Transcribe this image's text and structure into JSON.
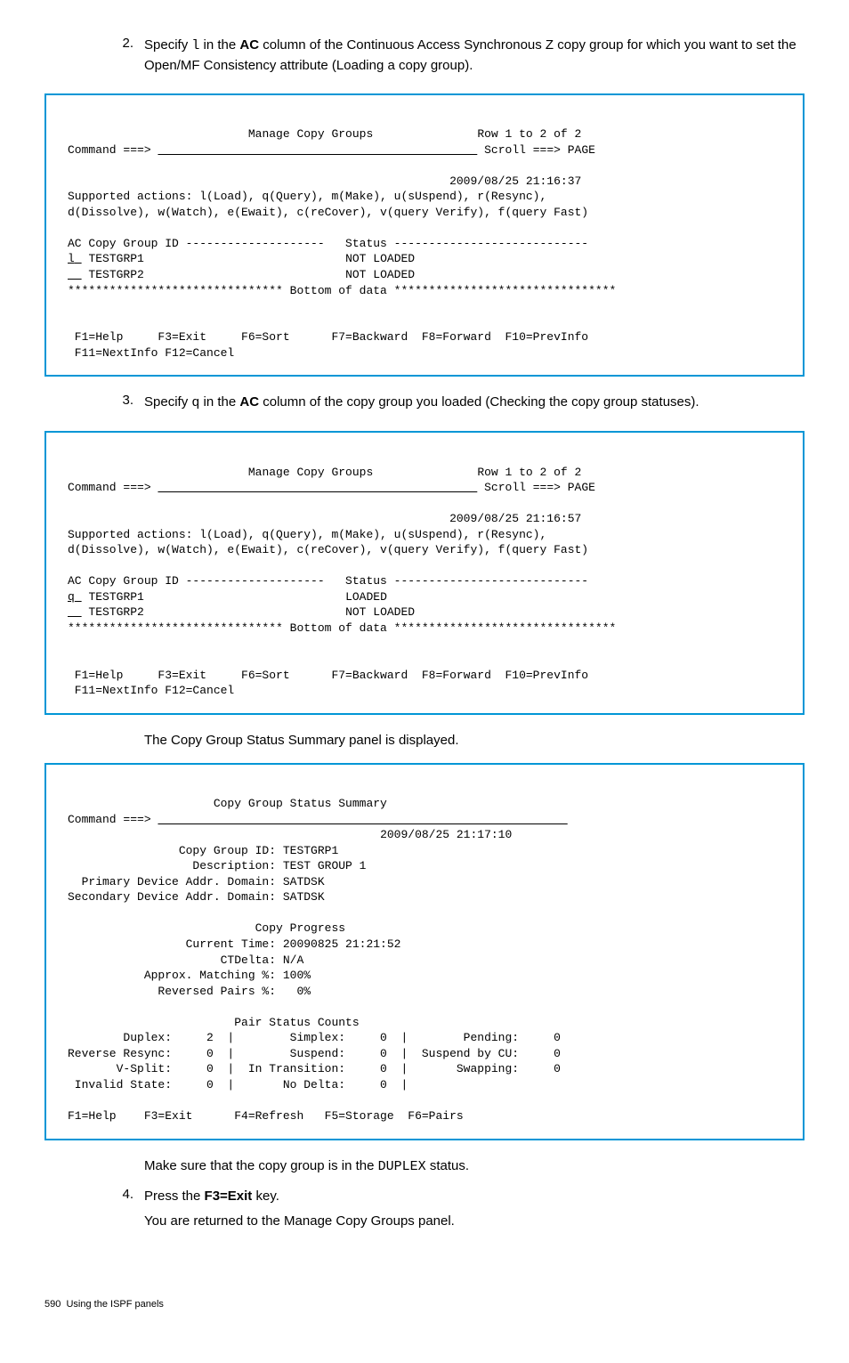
{
  "steps": {
    "s2": {
      "num": "2.",
      "text_before": "Specify ",
      "code": "l",
      "text_mid1": " in the ",
      "bold": "AC",
      "text_after": " column of the Continuous Access Synchronous Z copy group for which you want to set the Open/MF Consistency attribute (Loading a copy group)."
    },
    "s3": {
      "num": "3.",
      "text_before": "Specify ",
      "code": "q",
      "text_mid1": " in the ",
      "bold": "AC",
      "text_after": " column of the copy group you loaded (Checking the copy group statuses)."
    },
    "summary_line": "The Copy Group Status Summary panel is displayed.",
    "duplex_line_before": "Make sure that the copy group is in the ",
    "duplex_code": "DUPLEX",
    "duplex_line_after": " status.",
    "s4": {
      "num": "4.",
      "text_before": "Press the ",
      "bold": "F3=Exit",
      "text_after": " key.",
      "line2": "You are returned to the Manage Copy Groups panel."
    }
  },
  "term1": {
    "title": "Manage Copy Groups",
    "row": "Row 1 to 2 of 2",
    "cmd": "Command ===>",
    "scroll": "Scroll ===> PAGE",
    "ts": "2009/08/25 21:16:37",
    "sup1": "Supported actions: l(Load), q(Query), m(Make), u(sUspend), r(Resync),",
    "sup2": "d(Dissolve), w(Watch), e(Ewait), c(reCover), v(query Verify), f(query Fast)",
    "hdr": "AC Copy Group ID --------------------   Status ----------------------------",
    "r1ac": "l",
    "r1": "TESTGRP1                             NOT LOADED",
    "r2": "TESTGRP2                             NOT LOADED",
    "bottom": "******************************* Bottom of data ********************************",
    "keys1": " F1=Help     F3=Exit     F6=Sort      F7=Backward  F8=Forward  F10=PrevInfo",
    "keys2": " F11=NextInfo F12=Cancel"
  },
  "term2": {
    "title": "Manage Copy Groups",
    "row": "Row 1 to 2 of 2",
    "cmd": "Command ===>",
    "scroll": "Scroll ===> PAGE",
    "ts": "2009/08/25 21:16:57",
    "sup1": "Supported actions: l(Load), q(Query), m(Make), u(sUspend), r(Resync),",
    "sup2": "d(Dissolve), w(Watch), e(Ewait), c(reCover), v(query Verify), f(query Fast)",
    "hdr": "AC Copy Group ID --------------------   Status ----------------------------",
    "r1ac": "q",
    "r1": "TESTGRP1                             LOADED",
    "r2": "TESTGRP2                             NOT LOADED",
    "bottom": "******************************* Bottom of data ********************************",
    "keys1": " F1=Help     F3=Exit     F6=Sort      F7=Backward  F8=Forward  F10=PrevInfo",
    "keys2": " F11=NextInfo F12=Cancel"
  },
  "term3": {
    "title": "Copy Group Status Summary",
    "cmd": "Command ===>",
    "ts": "2009/08/25 21:17:10",
    "l1": "                Copy Group ID: TESTGRP1",
    "l2": "                  Description: TEST GROUP 1",
    "l3": "  Primary Device Addr. Domain: SATDSK",
    "l4": "Secondary Device Addr. Domain: SATDSK",
    "prog_hdr": "                           Copy Progress",
    "p1": "                 Current Time: 20090825 21:21:52",
    "p2": "                      CTDelta: N/A",
    "p3": "           Approx. Matching %: 100%",
    "p4": "             Reversed Pairs %:   0%",
    "psc_hdr": "                        Pair Status Counts",
    "c1": "        Duplex:     2  |        Simplex:     0  |        Pending:     0",
    "c2": "Reverse Resync:     0  |        Suspend:     0  |  Suspend by CU:     0",
    "c3": "       V-Split:     0  |  In Transition:     0  |       Swapping:     0",
    "c4": " Invalid State:     0  |       No Delta:     0  |",
    "keys": "F1=Help    F3=Exit      F4=Refresh   F5=Storage  F6=Pairs"
  },
  "footer": {
    "page": "590",
    "label": "Using the ISPF panels"
  }
}
